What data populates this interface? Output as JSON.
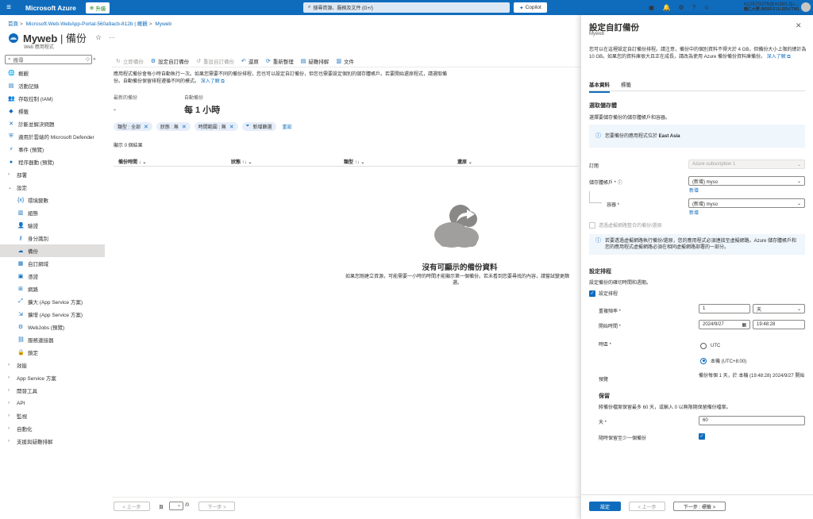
{
  "topbar": {
    "brand": "Microsoft Azure",
    "upgrade": "升級",
    "search_placeholder": "搜尋資源、服務及文件 (G+/)",
    "copilot": "Copilot",
    "user_email": "412570376@m365.fju...",
    "user_org": "輔仁大學 (M365.FJU.EDU.TW)"
  },
  "breadcrumb": {
    "home": "首頁",
    "item1": "Microsoft.Web-WebApp-Portal-560a9acb-812b | 概觀",
    "item2": "Myweb"
  },
  "page": {
    "name": "Myweb",
    "section": "| 備份",
    "subtitle": "Web 應用程式"
  },
  "sidebar": {
    "search_placeholder": "搜尋",
    "items": [
      {
        "label": "概觀",
        "icon": "globe-icon",
        "glyph": "🌐",
        "level": 0
      },
      {
        "label": "活動記錄",
        "icon": "log-icon",
        "glyph": "▤",
        "level": 0
      },
      {
        "label": "存取控制 (IAM)",
        "icon": "people-icon",
        "glyph": "👥",
        "level": 0
      },
      {
        "label": "標籤",
        "icon": "tag-icon",
        "glyph": "◆",
        "level": 0
      },
      {
        "label": "診斷並解決問題",
        "icon": "wrench-icon",
        "glyph": "✕",
        "level": 0
      },
      {
        "label": "適用於雲端的 Microsoft Defender",
        "icon": "shield-icon",
        "glyph": "⛨",
        "level": 0
      },
      {
        "label": "事件 (預覽)",
        "icon": "lightning-icon",
        "glyph": "⚡",
        "level": 0
      },
      {
        "label": "程序器動 (預覽)",
        "icon": "bulb-icon",
        "glyph": "●",
        "level": 0
      },
      {
        "label": "部署",
        "icon": "chevron-right-icon",
        "glyph": "",
        "level": 0,
        "arrow": "›"
      },
      {
        "label": "設定",
        "icon": "chevron-down-icon",
        "glyph": "",
        "level": 0,
        "arrow": "⌄"
      },
      {
        "label": "環境變數",
        "icon": "variable-icon",
        "glyph": "{x}",
        "level": 1
      },
      {
        "label": "組態",
        "icon": "config-icon",
        "glyph": "▥",
        "level": 1
      },
      {
        "label": "驗證",
        "icon": "auth-icon",
        "glyph": "👤",
        "level": 1
      },
      {
        "label": "身分識別",
        "icon": "identity-icon",
        "glyph": "⚷",
        "level": 1
      },
      {
        "label": "備份",
        "icon": "backup-cloud-icon",
        "glyph": "☁",
        "level": 1,
        "selected": true
      },
      {
        "label": "自訂網域",
        "icon": "domain-icon",
        "glyph": "▦",
        "level": 1
      },
      {
        "label": "憑證",
        "icon": "certificate-icon",
        "glyph": "▣",
        "level": 1
      },
      {
        "label": "網路",
        "icon": "network-icon",
        "glyph": "⊞",
        "level": 1
      },
      {
        "label": "擴大 (App Service 方案)",
        "icon": "scale-up-icon",
        "glyph": "⤢",
        "level": 1
      },
      {
        "label": "擴增 (App Service 方案)",
        "icon": "scale-out-icon",
        "glyph": "⇲",
        "level": 1
      },
      {
        "label": "WebJobs (預覽)",
        "icon": "webjobs-icon",
        "glyph": "⚙",
        "level": 1
      },
      {
        "label": "服務連接器",
        "icon": "connector-icon",
        "glyph": "⛓",
        "level": 1
      },
      {
        "label": "鎖定",
        "icon": "lock-icon",
        "glyph": "🔒",
        "level": 1
      },
      {
        "label": "效能",
        "icon": "chevron-right-icon",
        "glyph": "",
        "level": 0,
        "arrow": "›"
      },
      {
        "label": "App Service 方案",
        "icon": "chevron-right-icon",
        "glyph": "",
        "level": 0,
        "arrow": "›"
      },
      {
        "label": "開發工具",
        "icon": "chevron-right-icon",
        "glyph": "",
        "level": 0,
        "arrow": "›"
      },
      {
        "label": "API",
        "icon": "chevron-right-icon",
        "glyph": "",
        "level": 0,
        "arrow": "›"
      },
      {
        "label": "監視",
        "icon": "chevron-right-icon",
        "glyph": "",
        "level": 0,
        "arrow": "›"
      },
      {
        "label": "自動化",
        "icon": "chevron-right-icon",
        "glyph": "",
        "level": 0,
        "arrow": "›"
      },
      {
        "label": "支援與疑難排解",
        "icon": "chevron-right-icon",
        "glyph": "",
        "level": 0,
        "arrow": "›"
      }
    ]
  },
  "toolbar": {
    "backup_now": "立即備份",
    "configure": "設定自訂備份",
    "reset": "重設自訂備份",
    "restore": "還原",
    "refresh": "重新整理",
    "troubleshoot": "疑難排解",
    "docs": "文件"
  },
  "main": {
    "description": "應用程式備份會每小時自動執行一次。如果您需要不同的備份排程，您也可以設定自訂備份，但您也需要設定個別的儲存體帳戶。若要開始還原程式，請選取備份。自動備份保留排程遵循不同的模式。",
    "learn_more": "深入了解 ⧉",
    "last_backup_label": "最新的備份",
    "last_backup_value": "-",
    "auto_backup_label": "自動備份",
    "auto_backup_value": "每 1 小時",
    "filters": {
      "type": "類型 : 全部",
      "status": "狀態 : 無",
      "time": "時間範圍 : 無",
      "add": "新增篩選",
      "reset": "重設"
    },
    "result_count": "顯示 0 個結果",
    "columns": {
      "time": "備份時間 ↓",
      "status": "狀態 ↑↓",
      "type": "類型 ↑↓",
      "restore": "還原"
    },
    "empty_title": "沒有可顯示的備份資料",
    "empty_desc": "如果您剛建立資源，可能需要一小時的時間才能顯示第一個備份。若未看到您要尋找的內容，請嘗試變更篩選。",
    "pager": {
      "prev": "< 上一步",
      "page_label": "頁",
      "page_total": "/0",
      "next": "下一步 >"
    }
  },
  "panel": {
    "title": "設定自訂備份",
    "subtitle": "Myweb",
    "description": "您可以在這裡設定自訂備份排程。請注意，備份中的個別資料不得大於 4 GB，但備份大小上限的總計為 10 GB。如果您的資料庫很大且正在成長，請改為使用 Azure 備份備份資料庫備份。",
    "learn_more": "深入了解 ⧉",
    "tab_basic": "基本資料",
    "tab_tags": "標籤",
    "storage_title": "選取儲存體",
    "storage_desc": "選擇要儲存備份的儲存體帳戶和容器。",
    "region_info_prefix": "您要備份的應用程式位於 ",
    "region_info_bold": "East Asia",
    "subscription_label": "訂閱",
    "subscription_value": "Azure subscription 1",
    "storage_label": "儲存體帳戶 *",
    "storage_value": "(新增) myso",
    "storage_new": "新增",
    "container_label": "容器 *",
    "container_value": "(新增) myso",
    "container_new": "新增",
    "network_check": "透過虛擬網路整合的備份/還原",
    "network_info": "若要透過虛擬網路執行備份/還原，您的應用程式必須連接至虛擬網路。Azure 儲存體帳戶和您的應用程式虛擬網路必須在相同虛擬網路部署的一部分。",
    "schedule_title": "設定排程",
    "schedule_desc": "設定備份的確切時間和週期。",
    "schedule_check": "設定排程",
    "freq_label": "重複頻率 *",
    "freq_value": "1",
    "freq_unit": "天",
    "start_label": "開始時間 *",
    "start_date": "2024/9/27",
    "start_time": "19:48:28",
    "tz_label": "時區 *",
    "tz_utc": "UTC",
    "tz_local": "本機 (UTC+8:00)",
    "preview_label": "預覽",
    "preview_value": "備份每個 1 天，於 本機 (19:48:28) 2024/9/27 開始",
    "retention_title": "保留",
    "retention_desc": "將備份檔案保留最多 60 天，或輸入 0 以無限期保留備份檔案。",
    "days_label": "天 *",
    "days_value": "60",
    "keep_one_label": "隨時保留至少一個備份",
    "btn_configure": "設定",
    "btn_prev": "< 上一步",
    "btn_next": "下一步 : 標籤 >"
  },
  "colors": {
    "azure_blue": "#0f6cbd",
    "selected_bg": "#e1dfdd",
    "info_bg": "#eff6fc"
  }
}
